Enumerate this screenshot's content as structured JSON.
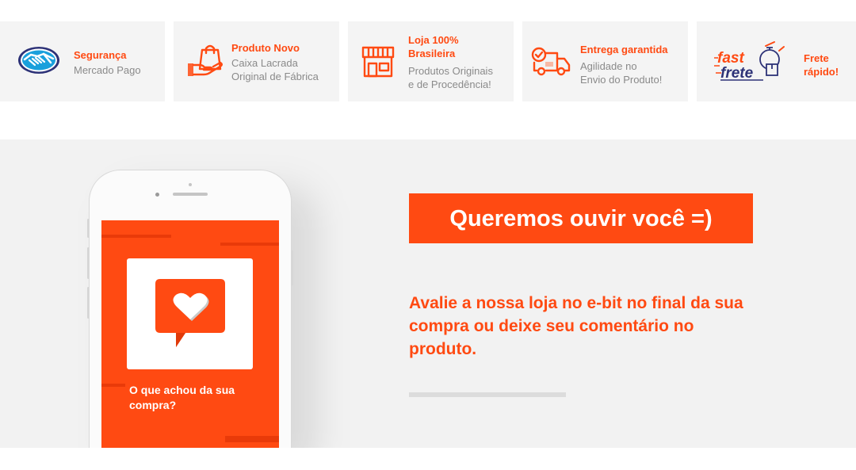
{
  "features": [
    {
      "icon": "handshake-icon",
      "title": "Segurança",
      "desc": [
        "Mercado Pago"
      ]
    },
    {
      "icon": "shopping-bag-hand-icon",
      "title": "Produto Novo",
      "desc": [
        "Caixa Lacrada",
        "Original de Fábrica"
      ]
    },
    {
      "icon": "storefront-icon",
      "title_lines": [
        "Loja 100%",
        "Brasileira"
      ],
      "desc": [
        "Produtos Originais",
        "e de Procedência!"
      ]
    },
    {
      "icon": "delivery-truck-icon",
      "title": "Entrega garantida",
      "desc": [
        "Agilidade no",
        "Envio do Produto!"
      ]
    },
    {
      "icon": "fast-frete-logo",
      "logo_text": [
        "fast",
        "frete"
      ],
      "title_lines": [
        "Frete",
        "rápido!"
      ]
    }
  ],
  "promo": {
    "headline": "Queremos ouvir você =)",
    "body": "Avalie a nossa loja no e-bit no final da sua compra ou deixe seu comentário no produto.",
    "phone_screen": {
      "icon": "heart-speech-bubble-icon",
      "text": "O que achou da sua compra?"
    }
  },
  "colors": {
    "accent": "#ff4a12",
    "tile_bg": "#f4f4f4",
    "section_bg": "#f2f2f2",
    "muted_text": "#8a8a8a",
    "mercado_pago_blue": "#2d3277"
  }
}
